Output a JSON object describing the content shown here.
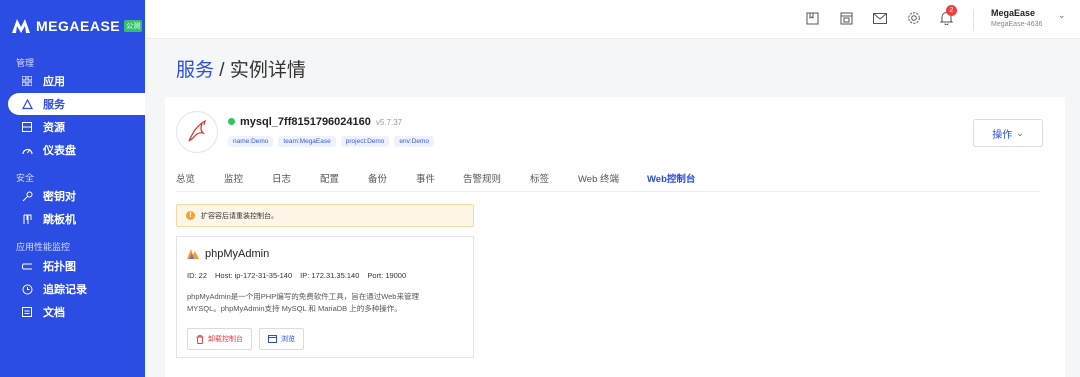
{
  "brand": {
    "name": "MEGAEASE",
    "badge": "公测"
  },
  "sidebar": {
    "sections": [
      {
        "title": "管理",
        "items": [
          {
            "label": "应用",
            "icon": "grid-icon"
          },
          {
            "label": "服务",
            "icon": "services-icon",
            "active": true
          },
          {
            "label": "资源",
            "icon": "resource-icon"
          },
          {
            "label": "仪表盘",
            "icon": "dashboard-icon"
          }
        ]
      },
      {
        "title": "安全",
        "items": [
          {
            "label": "密钥对",
            "icon": "key-icon"
          },
          {
            "label": "跳板机",
            "icon": "jump-host-icon"
          }
        ]
      },
      {
        "title": "应用性能监控",
        "items": [
          {
            "label": "拓扑图",
            "icon": "topology-icon"
          },
          {
            "label": "追踪记录",
            "icon": "trace-icon"
          },
          {
            "label": "文档",
            "icon": "doc-icon"
          }
        ]
      }
    ]
  },
  "topbar": {
    "notification_count": "2",
    "user": {
      "name": "MegaEase",
      "account": "MegaEase-4636"
    }
  },
  "breadcrumb": {
    "parent": "服务",
    "separator": " / ",
    "current": "实例详情"
  },
  "service": {
    "name": "mysql_7ff8151796024160",
    "version": "v5.7.37",
    "status_color": "#32c25b",
    "tags": [
      "name:Demo",
      "team:MegaEase",
      "project:Demo",
      "env:Demo"
    ],
    "action_label": "操作"
  },
  "tabs": [
    "总览",
    "监控",
    "日志",
    "配置",
    "备份",
    "事件",
    "告警规则",
    "标签",
    "Web 终端",
    "Web控制台"
  ],
  "active_tab": "Web控制台",
  "alert": {
    "text": "扩容容后请重装控制台。"
  },
  "console": {
    "title": "phpMyAdmin",
    "id": "ID: 22",
    "host": "Host: ip-172-31-35-140",
    "ip": "IP: 172.31.35.140",
    "port": "Port: 19000",
    "desc_line1": "phpMyAdmin是一个用PHP编写的免费软件工具，旨在通过Web来管理",
    "desc_line2": "MYSQL。phpMyAdmin支持 MySQL 和 MariaDB 上的多种操作。",
    "uninstall_label": "卸载控制台",
    "browse_label": "浏览"
  },
  "colors": {
    "accent": "#2b4de4",
    "danger": "#e53b3b",
    "success": "#32c25b",
    "warning": "#f5a623"
  }
}
